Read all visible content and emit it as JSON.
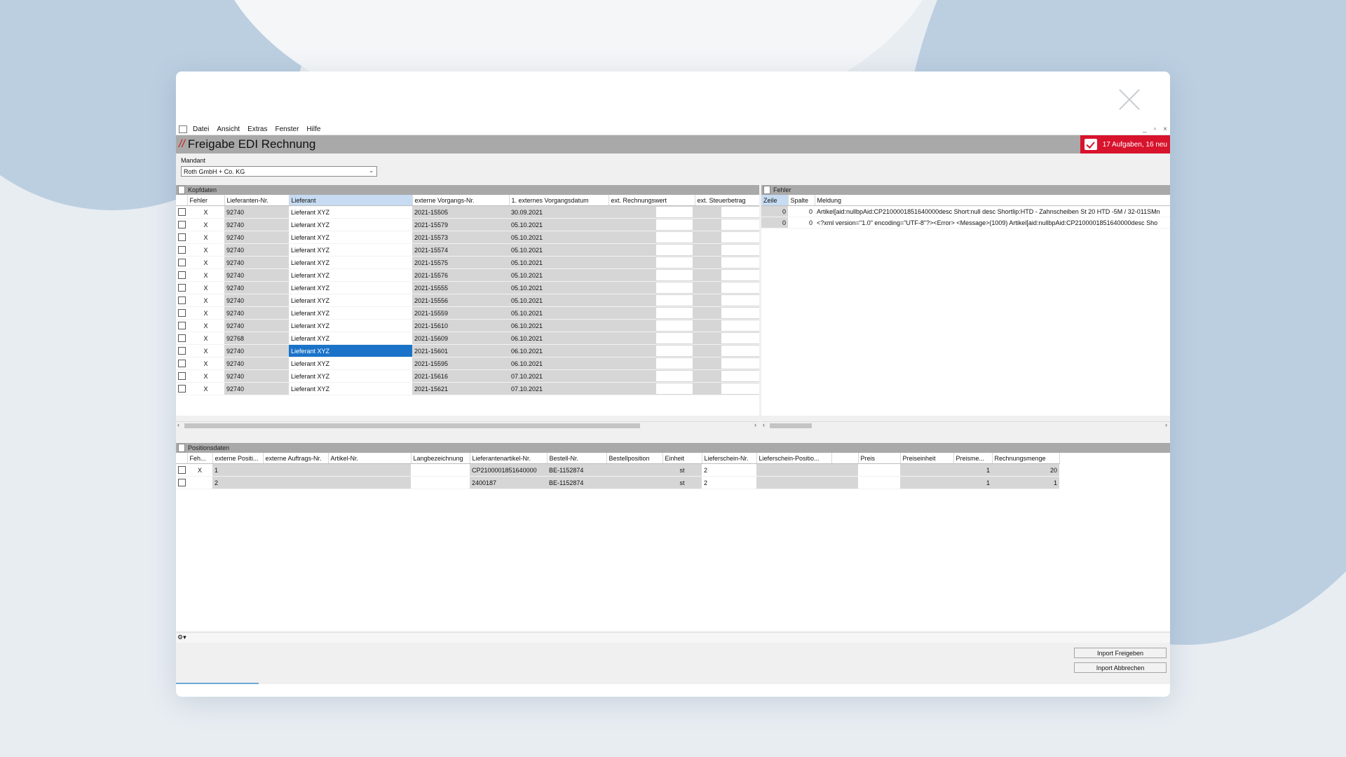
{
  "menu": [
    "Datei",
    "Ansicht",
    "Extras",
    "Fenster",
    "Hilfe"
  ],
  "window_controls": [
    "_",
    "▫",
    "×"
  ],
  "app": {
    "title": "Freigabe EDI Rechnung",
    "title_prefix": "//",
    "tasks": "17 Aufgaben, 16 neu"
  },
  "mandant": {
    "label": "Mandant",
    "value": "Roth GmbH + Co. KG"
  },
  "kopfdaten": {
    "title": "Kopfdaten",
    "columns": [
      "",
      "Fehler",
      "Lieferanten-Nr.",
      "Lieferant",
      "externe Vorgangs-Nr.",
      "1. externes Vorgangsdatum",
      "ext. Rechnungswert",
      "ext. Steuerbetrag"
    ],
    "selected_row": 11,
    "rows": [
      {
        "fehler": "X",
        "nr": "92740",
        "lieferant": "Lieferant XYZ",
        "vorgang": "2021-15505",
        "datum": "30.09.2021"
      },
      {
        "fehler": "X",
        "nr": "92740",
        "lieferant": "Lieferant XYZ",
        "vorgang": "2021-15579",
        "datum": "05.10.2021"
      },
      {
        "fehler": "X",
        "nr": "92740",
        "lieferant": "Lieferant XYZ",
        "vorgang": "2021-15573",
        "datum": "05.10.2021"
      },
      {
        "fehler": "X",
        "nr": "92740",
        "lieferant": "Lieferant XYZ",
        "vorgang": "2021-15574",
        "datum": "05.10.2021"
      },
      {
        "fehler": "X",
        "nr": "92740",
        "lieferant": "Lieferant XYZ",
        "vorgang": "2021-15575",
        "datum": "05.10.2021"
      },
      {
        "fehler": "X",
        "nr": "92740",
        "lieferant": "Lieferant XYZ",
        "vorgang": "2021-15576",
        "datum": "05.10.2021"
      },
      {
        "fehler": "X",
        "nr": "92740",
        "lieferant": "Lieferant XYZ",
        "vorgang": "2021-15555",
        "datum": "05.10.2021"
      },
      {
        "fehler": "X",
        "nr": "92740",
        "lieferant": "Lieferant XYZ",
        "vorgang": "2021-15556",
        "datum": "05.10.2021"
      },
      {
        "fehler": "X",
        "nr": "92740",
        "lieferant": "Lieferant XYZ",
        "vorgang": "2021-15559",
        "datum": "05.10.2021"
      },
      {
        "fehler": "X",
        "nr": "92740",
        "lieferant": "Lieferant XYZ",
        "vorgang": "2021-15610",
        "datum": "06.10.2021"
      },
      {
        "fehler": "X",
        "nr": "92768",
        "lieferant": "Lieferant XYZ",
        "vorgang": "2021-15609",
        "datum": "06.10.2021"
      },
      {
        "fehler": "X",
        "nr": "92740",
        "lieferant": "Lieferant XYZ",
        "vorgang": "2021-15601",
        "datum": "06.10.2021"
      },
      {
        "fehler": "X",
        "nr": "92740",
        "lieferant": "Lieferant XYZ",
        "vorgang": "2021-15595",
        "datum": "06.10.2021"
      },
      {
        "fehler": "X",
        "nr": "92740",
        "lieferant": "Lieferant XYZ",
        "vorgang": "2021-15616",
        "datum": "07.10.2021"
      },
      {
        "fehler": "X",
        "nr": "92740",
        "lieferant": "Lieferant XYZ",
        "vorgang": "2021-15621",
        "datum": "07.10.2021"
      }
    ]
  },
  "fehler": {
    "title": "Fehler",
    "columns": [
      "Zeile",
      "Spalte",
      "Meldung"
    ],
    "rows": [
      {
        "zeile": "0",
        "spalte": "0",
        "meldung": "Artikel[aid:nullbpAid:CP2100001851640000desc Short:null desc Shortlip:HTD - Zahnscheiben St 20 HTD -5M / 32-011SMn"
      },
      {
        "zeile": "0",
        "spalte": "0",
        "meldung": "<?xml version=\"1.0\" encoding=\"UTF-8\"?><Error> <Message>(1009) Artikel[aid:nullbpAid:CP2100001851640000desc Sho"
      }
    ]
  },
  "positionsdaten": {
    "title": "Positionsdaten",
    "columns": [
      "",
      "Feh...",
      "externe Positi...",
      "externe Auftrags-Nr.",
      "Artikel-Nr.",
      "Langbezeichnung",
      "Lieferantenartikel-Nr.",
      "Bestell-Nr.",
      "Bestellposition",
      "Einheit",
      "Lieferschein-Nr.",
      "Lieferschein-Positio...",
      "",
      "Preis",
      "Preiseinheit",
      "Preisme...",
      "Rechnungsmenge"
    ],
    "rows": [
      {
        "fehler": "X",
        "pos": "1",
        "lieferant_art": "CP2100001851640000",
        "bestell": "BE-1152874",
        "einheit": "st",
        "ls": "2",
        "preismenge": "1",
        "menge": "20"
      },
      {
        "fehler": "",
        "pos": "2",
        "lieferant_art": "2400187",
        "bestell": "BE-1152874",
        "einheit": "st",
        "ls": "2",
        "preismenge": "1",
        "menge": "1"
      }
    ]
  },
  "toolbar_icon": "⚙▾",
  "buttons": {
    "freigeben": "Inport Freigeben",
    "abbrechen": "Inport Abbrechen"
  },
  "progress": 0.083,
  "colors": {
    "accent": "#d8132c",
    "selection": "#1a73c8",
    "header_gray": "#a9a9a9"
  }
}
